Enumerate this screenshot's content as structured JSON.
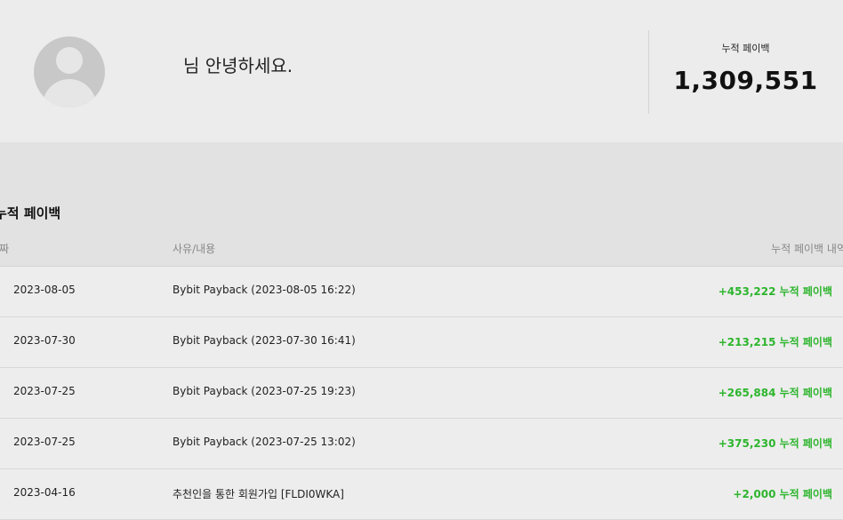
{
  "profile": {
    "greeting": "님 안녕하세요.",
    "total_label": "누적 페이백",
    "total_value": "1,309,551"
  },
  "history": {
    "title": "누적 페이백",
    "columns": {
      "date": "날짜",
      "reason": "사유/내용",
      "amount": "누적 페이백 내역"
    },
    "rows": [
      {
        "date": "2023-08-05",
        "reason": "Bybit Payback (2023-08-05 16:22)",
        "amount": "+453,222 누적 페이백"
      },
      {
        "date": "2023-07-30",
        "reason": "Bybit Payback (2023-07-30 16:41)",
        "amount": "+213,215 누적 페이백"
      },
      {
        "date": "2023-07-25",
        "reason": "Bybit Payback (2023-07-25 19:23)",
        "amount": "+265,884 누적 페이백"
      },
      {
        "date": "2023-07-25",
        "reason": "Bybit Payback (2023-07-25 13:02)",
        "amount": "+375,230 누적 페이백"
      },
      {
        "date": "2023-04-16",
        "reason": "추천인을 통한 회원가입 [FLDI0WKA]",
        "amount": "+2,000 누적 페이백"
      }
    ]
  },
  "colors": {
    "positive": "#2db52d",
    "background": "#ececec",
    "band": "#e2e2e2"
  }
}
